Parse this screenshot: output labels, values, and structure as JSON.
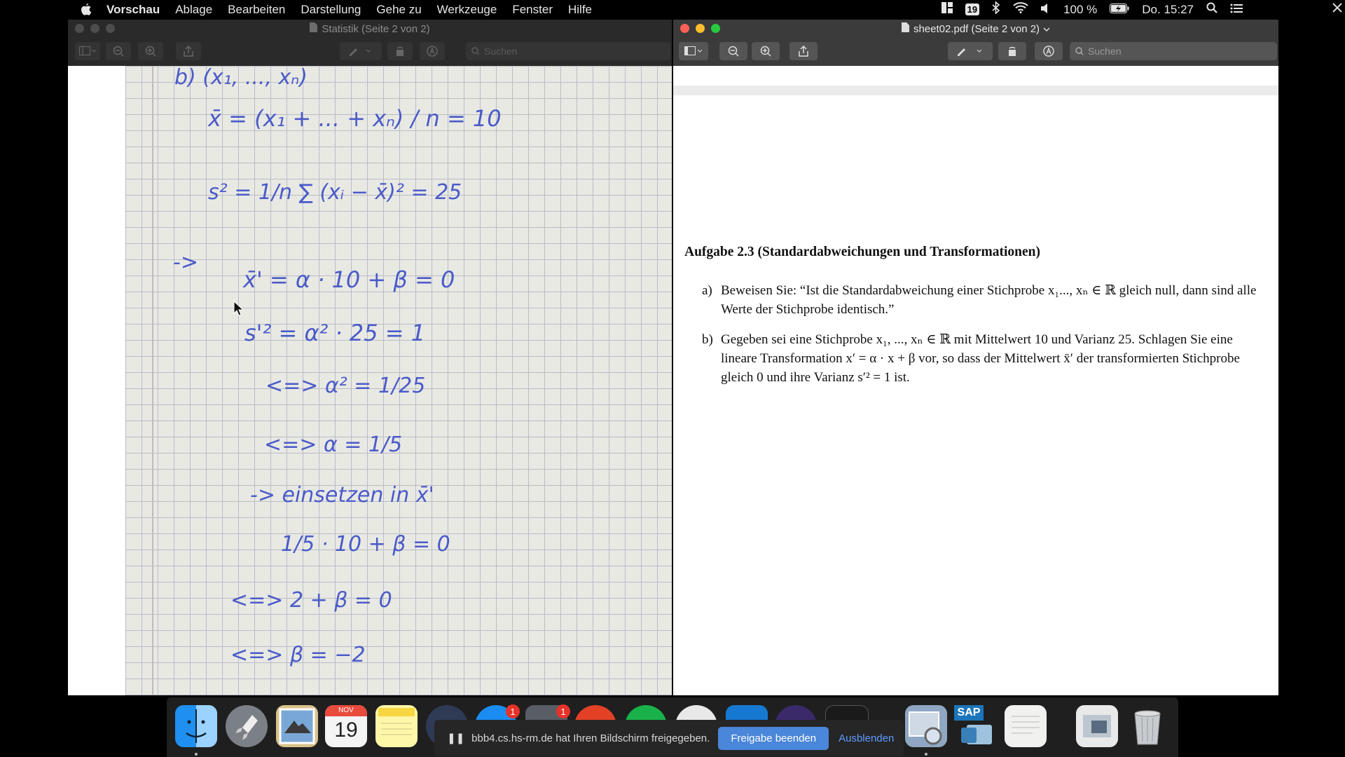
{
  "menubar": {
    "app_name": "Vorschau",
    "items": [
      "Ablage",
      "Bearbeiten",
      "Darstellung",
      "Gehe zu",
      "Werkzeuge",
      "Fenster",
      "Hilfe"
    ],
    "calendar_badge": "19",
    "battery": "100 %",
    "clock": "Do. 15:27"
  },
  "left_window": {
    "title": "Statistik (Seite 2 von 2)",
    "search_placeholder": "Suchen",
    "handwriting": [
      "b)        (x₁, ..., xₙ)",
      "x̄ = (x₁ + ... + xₙ) / n = 10",
      "s² = 1/n ∑ (xᵢ − x̄)² = 25",
      "->",
      "x̄' = α · 10 + β = 0",
      "s'² = α² · 25 = 1",
      "<=> α²   = 1/25",
      "<=> α    = 1/5",
      "-> einsetzen in x̄'",
      "1/5 · 10 + β = 0",
      "<=>  2 + β = 0",
      "<=>     β = −2"
    ]
  },
  "right_window": {
    "title": "sheet02.pdf (Seite 2 von 2)",
    "search_placeholder": "Suchen",
    "task_title": "Aufgabe 2.3 (Standardabweichungen und Transformationen)",
    "parts": [
      {
        "label": "a)",
        "text": "Beweisen Sie: “Ist die Standardabweichung einer Stichprobe x₁..., xₙ ∈ ℝ gleich null, dann sind alle Werte der Stichprobe identisch.”"
      },
      {
        "label": "b)",
        "text": "Gegeben sei eine Stichprobe x₁, ..., xₙ ∈ ℝ mit Mittelwert 10 und Varianz 25. Schlagen Sie eine lineare Transformation x′ = α · x + β vor, so dass der Mittelwert x̄′ der transformierten Stichprobe gleich 0 und ihre Varianz s′² = 1 ist."
      }
    ]
  },
  "dock": {
    "calendar_month": "NOV",
    "calendar_day": "19",
    "badge_mail": "1",
    "badge_other": "1",
    "sap_label": "SAP",
    "share_message": "bbb4.cs.hs-rm.de hat Ihren Bildschirm freigegeben.",
    "stop_sharing": "Freigabe beenden",
    "hide": "Ausblenden"
  }
}
